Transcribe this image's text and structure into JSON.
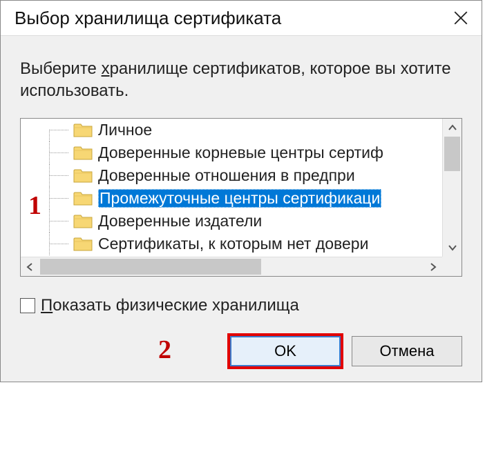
{
  "window": {
    "title": "Выбор хранилища сертификата"
  },
  "instruction": {
    "text_prefix": "Выберите ",
    "text_underlined": "х",
    "text_suffix": "ранилище сертификатов, которое вы хотите использовать."
  },
  "tree": {
    "items": [
      {
        "label": "Личное",
        "selected": false
      },
      {
        "label": "Доверенные корневые центры сертиф",
        "selected": false
      },
      {
        "label": "Доверенные отношения в предпри",
        "selected": false
      },
      {
        "label": "Промежуточные центры сертификаци",
        "selected": true
      },
      {
        "label": "Доверенные издатели",
        "selected": false
      },
      {
        "label": "Сертификаты, к которым нет довери",
        "selected": false
      }
    ]
  },
  "checkbox": {
    "u": "П",
    "label": "оказать физические хранилища",
    "checked": false
  },
  "buttons": {
    "ok": "OK",
    "cancel": "Отмена"
  },
  "annotations": {
    "one": "1",
    "two": "2"
  }
}
